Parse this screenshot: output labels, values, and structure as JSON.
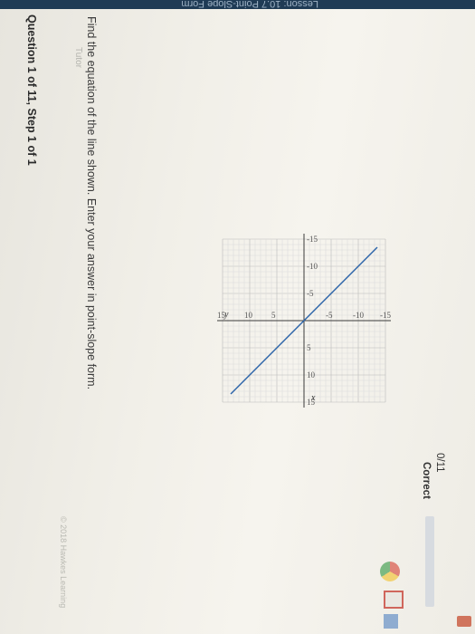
{
  "header": {
    "lesson_title": "Lesson: 10.7 Point-Slope Form",
    "question_progress": "Question 1 of 11, Step 1 of 1",
    "score": "0/11",
    "status": "Correct"
  },
  "question": {
    "instruction": "Find the equation of the line shown. Enter your answer in point-slope form."
  },
  "footer": {
    "instructor": "Tutor",
    "copyright": "© 2018 Hawkes Learning"
  },
  "chart_data": {
    "type": "line",
    "xlabel": "x",
    "ylabel": "y",
    "xlim": [
      -15,
      15
    ],
    "ylim": [
      -15,
      15
    ],
    "grid": true,
    "x_tick_labels": [
      "-15",
      "-10",
      "-5",
      "5",
      "10",
      "15"
    ],
    "y_tick_labels": [
      "15",
      "10",
      "5",
      "-5",
      "-10",
      "-15"
    ],
    "series": [
      {
        "points": [
          [
            -10,
            -10
          ],
          [
            10,
            10
          ]
        ],
        "color": "#2a63a8"
      }
    ]
  },
  "colors": {
    "accent": "#1f3b55",
    "line": "#2a63a8",
    "status_bar": "#d7dbe0"
  }
}
